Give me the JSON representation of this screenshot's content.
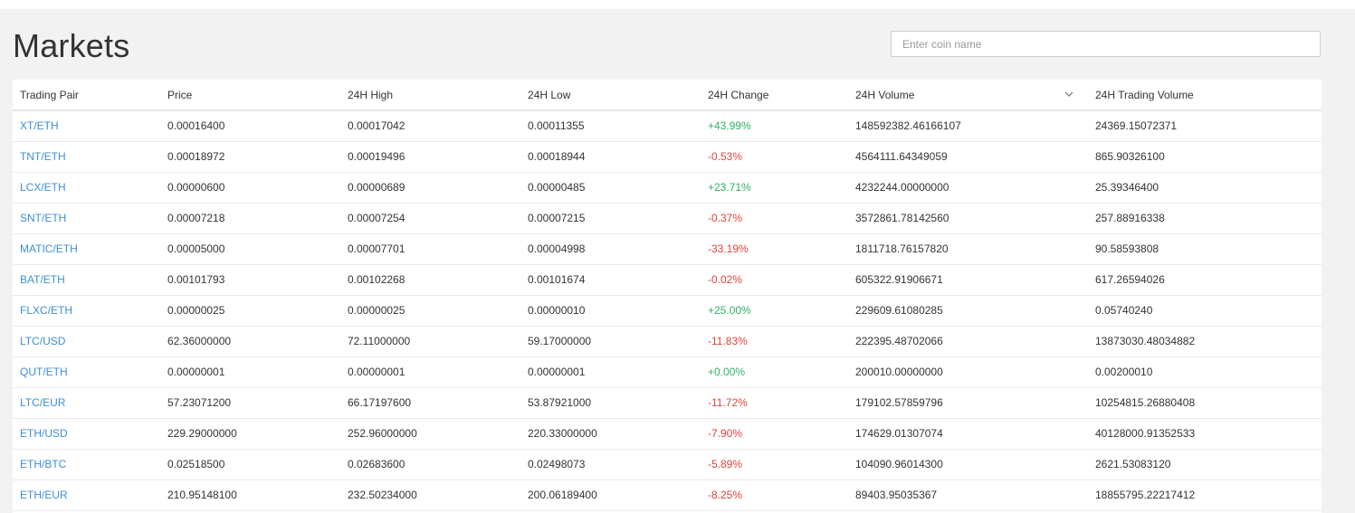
{
  "header": {
    "title": "Markets",
    "search_placeholder": "Enter coin name"
  },
  "table": {
    "columns": [
      "Trading Pair",
      "Price",
      "24H High",
      "24H Low",
      "24H Change",
      "24H Volume",
      "24H Trading Volume"
    ],
    "sorted_column_icon": "chevron-down-icon",
    "colors": {
      "link": "#3d8fd8",
      "positive": "#2fb265",
      "negative": "#e0433d"
    },
    "rows": [
      {
        "pair": "XT/ETH",
        "price": "0.00016400",
        "high": "0.00017042",
        "low": "0.00011355",
        "change": "+43.99%",
        "volume": "148592382.46166107",
        "trading_volume": "24369.15072371"
      },
      {
        "pair": "TNT/ETH",
        "price": "0.00018972",
        "high": "0.00019496",
        "low": "0.00018944",
        "change": "-0.53%",
        "volume": "4564111.64349059",
        "trading_volume": "865.90326100"
      },
      {
        "pair": "LCX/ETH",
        "price": "0.00000600",
        "high": "0.00000689",
        "low": "0.00000485",
        "change": "+23.71%",
        "volume": "4232244.00000000",
        "trading_volume": "25.39346400"
      },
      {
        "pair": "SNT/ETH",
        "price": "0.00007218",
        "high": "0.00007254",
        "low": "0.00007215",
        "change": "-0.37%",
        "volume": "3572861.78142560",
        "trading_volume": "257.88916338"
      },
      {
        "pair": "MATIC/ETH",
        "price": "0.00005000",
        "high": "0.00007701",
        "low": "0.00004998",
        "change": "-33.19%",
        "volume": "1811718.76157820",
        "trading_volume": "90.58593808"
      },
      {
        "pair": "BAT/ETH",
        "price": "0.00101793",
        "high": "0.00102268",
        "low": "0.00101674",
        "change": "-0.02%",
        "volume": "605322.91906671",
        "trading_volume": "617.26594026"
      },
      {
        "pair": "FLXC/ETH",
        "price": "0.00000025",
        "high": "0.00000025",
        "low": "0.00000010",
        "change": "+25.00%",
        "volume": "229609.61080285",
        "trading_volume": "0.05740240"
      },
      {
        "pair": "LTC/USD",
        "price": "62.36000000",
        "high": "72.11000000",
        "low": "59.17000000",
        "change": "-11.83%",
        "volume": "222395.48702066",
        "trading_volume": "13873030.48034882"
      },
      {
        "pair": "QUT/ETH",
        "price": "0.00000001",
        "high": "0.00000001",
        "low": "0.00000001",
        "change": "+0.00%",
        "volume": "200010.00000000",
        "trading_volume": "0.00200010"
      },
      {
        "pair": "LTC/EUR",
        "price": "57.23071200",
        "high": "66.17197600",
        "low": "53.87921000",
        "change": "-11.72%",
        "volume": "179102.57859796",
        "trading_volume": "10254815.26880408"
      },
      {
        "pair": "ETH/USD",
        "price": "229.29000000",
        "high": "252.96000000",
        "low": "220.33000000",
        "change": "-7.90%",
        "volume": "174629.01307074",
        "trading_volume": "40128000.91352533"
      },
      {
        "pair": "ETH/BTC",
        "price": "0.02518500",
        "high": "0.02683600",
        "low": "0.02498073",
        "change": "-5.89%",
        "volume": "104090.96014300",
        "trading_volume": "2621.53083120"
      },
      {
        "pair": "ETH/EUR",
        "price": "210.95148100",
        "high": "232.50234000",
        "low": "200.06189400",
        "change": "-8.25%",
        "volume": "89403.95035367",
        "trading_volume": "18855795.22217412"
      }
    ]
  }
}
